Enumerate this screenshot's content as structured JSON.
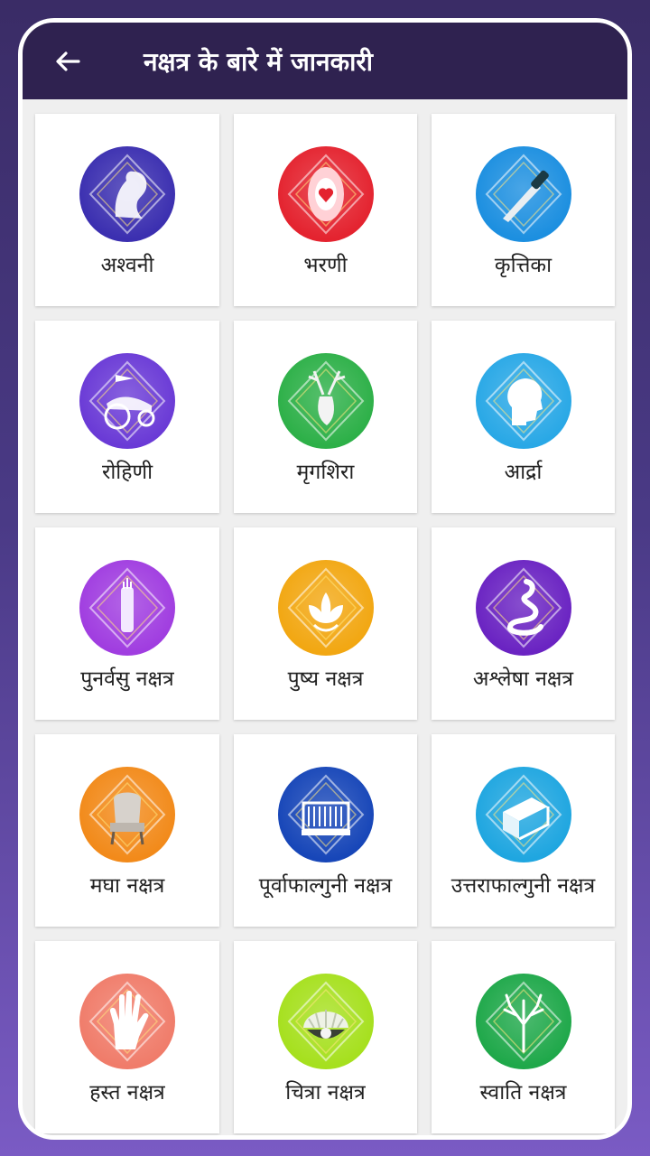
{
  "header": {
    "title": "नक्षत्र के बारे में जानकारी"
  },
  "items": [
    {
      "label": "अश्वनी",
      "icon": "horse-icon",
      "color": "#3b2fb0"
    },
    {
      "label": "भरणी",
      "icon": "yoni-icon",
      "color": "#e4232f"
    },
    {
      "label": "कृत्तिका",
      "icon": "knife-icon",
      "color": "#1c8fe0"
    },
    {
      "label": "रोहिणी",
      "icon": "chariot-icon",
      "color": "#6a3ad6"
    },
    {
      "label": "मृगशिरा",
      "icon": "deer-icon",
      "color": "#2db048"
    },
    {
      "label": "आर्द्रा",
      "icon": "head-icon",
      "color": "#29a8e6"
    },
    {
      "label": "पुनर्वसु नक्षत्र",
      "icon": "quiver-icon",
      "color": "#a03de0"
    },
    {
      "label": "पुष्य नक्षत्र",
      "icon": "lotus-icon",
      "color": "#f2a712"
    },
    {
      "label": "अश्लेषा नक्षत्र",
      "icon": "snake-icon",
      "color": "#6a23c2"
    },
    {
      "label": "मघा नक्षत्र",
      "icon": "throne-icon",
      "color": "#f28a1a"
    },
    {
      "label": "पूर्वाफाल्गुनी नक्षत्र",
      "icon": "bed-front-icon",
      "color": "#1746b8"
    },
    {
      "label": "उत्तराफाल्गुनी नक्षत्र",
      "icon": "bed-icon",
      "color": "#1fa6e0"
    },
    {
      "label": "हस्त नक्षत्र",
      "icon": "hand-icon",
      "color": "#f07c6a"
    },
    {
      "label": "चित्रा नक्षत्र",
      "icon": "pearl-shell-icon",
      "color": "#a6e01e"
    },
    {
      "label": "स्वाति नक्षत्र",
      "icon": "tree-icon",
      "color": "#1fa84a"
    }
  ]
}
